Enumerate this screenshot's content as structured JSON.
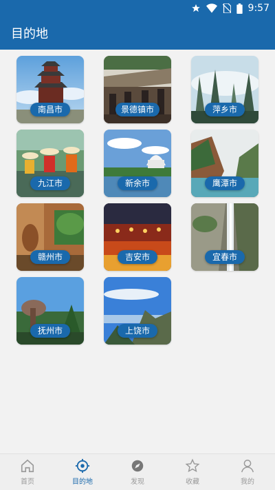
{
  "status_bar": {
    "time": "9:57",
    "icons": [
      "star-icon",
      "wifi-icon",
      "no-sim-icon",
      "battery-icon"
    ]
  },
  "app_bar": {
    "title": "目的地"
  },
  "colors": {
    "primary": "#1a69ac",
    "inactive": "#9a9a9a",
    "background": "#f2f2f2"
  },
  "cities": [
    {
      "label": "南昌市"
    },
    {
      "label": "景德镇市"
    },
    {
      "label": "萍乡市"
    },
    {
      "label": "九江市"
    },
    {
      "label": "新余市"
    },
    {
      "label": "鹰潭市"
    },
    {
      "label": "赣州市"
    },
    {
      "label": "吉安市"
    },
    {
      "label": "宜春市"
    },
    {
      "label": "抚州市"
    },
    {
      "label": "上饶市"
    }
  ],
  "bottom_nav": [
    {
      "label": "首页",
      "icon": "home-icon",
      "active": false
    },
    {
      "label": "目的地",
      "icon": "target-icon",
      "active": true
    },
    {
      "label": "发现",
      "icon": "compass-icon",
      "active": false
    },
    {
      "label": "收藏",
      "icon": "star-outline-icon",
      "active": false
    },
    {
      "label": "我的",
      "icon": "user-icon",
      "active": false
    }
  ]
}
